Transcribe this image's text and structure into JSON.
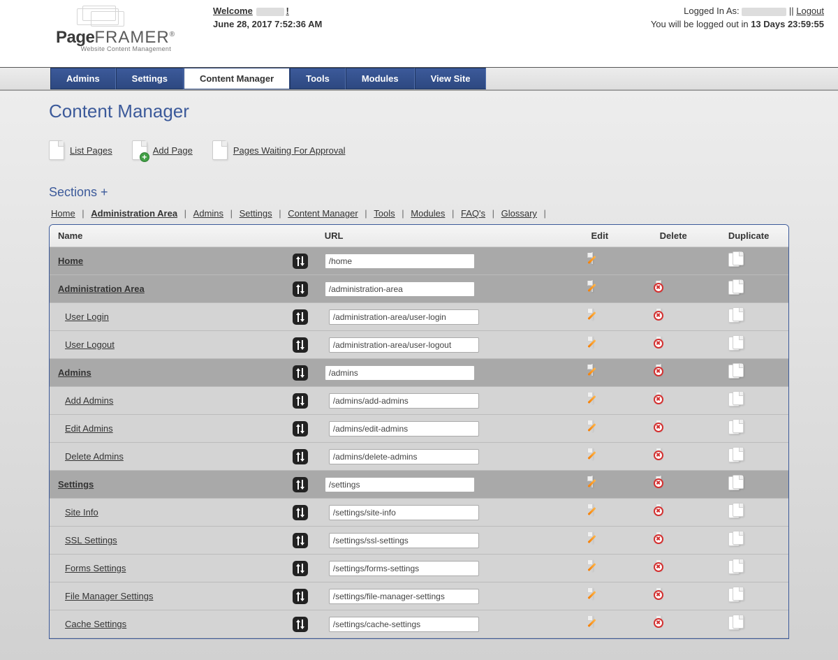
{
  "header": {
    "logo_page": "Page",
    "logo_framer": "FRAMER",
    "logo_sub": "Website Content Management",
    "welcome_prefix": "Welcome",
    "datetime": "June 28, 2017 7:52:36 AM",
    "logged_in_as_prefix": "Logged In As:",
    "logout_label": "Logout",
    "logout_timer_prefix": "You will be logged out in ",
    "logout_timer_value": "13 Days 23:59:55"
  },
  "nav": {
    "items": [
      "Admins",
      "Settings",
      "Content Manager",
      "Tools",
      "Modules",
      "View Site"
    ],
    "active_index": 2
  },
  "page": {
    "title": "Content Manager",
    "actions": {
      "list_pages": "List Pages",
      "add_page": "Add Page",
      "approval": "Pages Waiting For Approval"
    },
    "sections_label": "Sections +"
  },
  "breadcrumb": {
    "items": [
      "Home",
      "Administration Area",
      "Admins",
      "Settings",
      "Content Manager",
      "Tools",
      "Modules",
      "FAQ's",
      "Glossary"
    ],
    "active_index": 1
  },
  "table": {
    "headers": {
      "name": "Name",
      "url": "URL",
      "edit": "Edit",
      "delete": "Delete",
      "duplicate": "Duplicate"
    },
    "rows": [
      {
        "name": "Home",
        "url": "/home",
        "level": 0,
        "edit": true,
        "delete": false,
        "dup": true
      },
      {
        "name": "Administration Area",
        "url": "/administration-area",
        "level": 0,
        "edit": true,
        "delete": true,
        "dup": true
      },
      {
        "name": "User Login",
        "url": "/administration-area/user-login",
        "level": 1,
        "edit": true,
        "delete": true,
        "dup": true
      },
      {
        "name": "User Logout",
        "url": "/administration-area/user-logout",
        "level": 1,
        "edit": true,
        "delete": true,
        "dup": true
      },
      {
        "name": "Admins",
        "url": "/admins",
        "level": 0,
        "edit": true,
        "delete": true,
        "dup": true
      },
      {
        "name": "Add Admins",
        "url": "/admins/add-admins",
        "level": 1,
        "edit": true,
        "delete": true,
        "dup": true
      },
      {
        "name": "Edit Admins",
        "url": "/admins/edit-admins",
        "level": 1,
        "edit": true,
        "delete": true,
        "dup": true
      },
      {
        "name": "Delete Admins",
        "url": "/admins/delete-admins",
        "level": 1,
        "edit": true,
        "delete": true,
        "dup": true
      },
      {
        "name": "Settings",
        "url": "/settings",
        "level": 0,
        "edit": true,
        "delete": true,
        "dup": true
      },
      {
        "name": "Site Info",
        "url": "/settings/site-info",
        "level": 1,
        "edit": true,
        "delete": true,
        "dup": true
      },
      {
        "name": "SSL Settings",
        "url": "/settings/ssl-settings",
        "level": 1,
        "edit": true,
        "delete": true,
        "dup": true
      },
      {
        "name": "Forms Settings",
        "url": "/settings/forms-settings",
        "level": 1,
        "edit": true,
        "delete": true,
        "dup": true
      },
      {
        "name": "File Manager Settings",
        "url": "/settings/file-manager-settings",
        "level": 1,
        "edit": true,
        "delete": true,
        "dup": true
      },
      {
        "name": "Cache Settings",
        "url": "/settings/cache-settings",
        "level": 1,
        "edit": true,
        "delete": true,
        "dup": true
      }
    ]
  }
}
